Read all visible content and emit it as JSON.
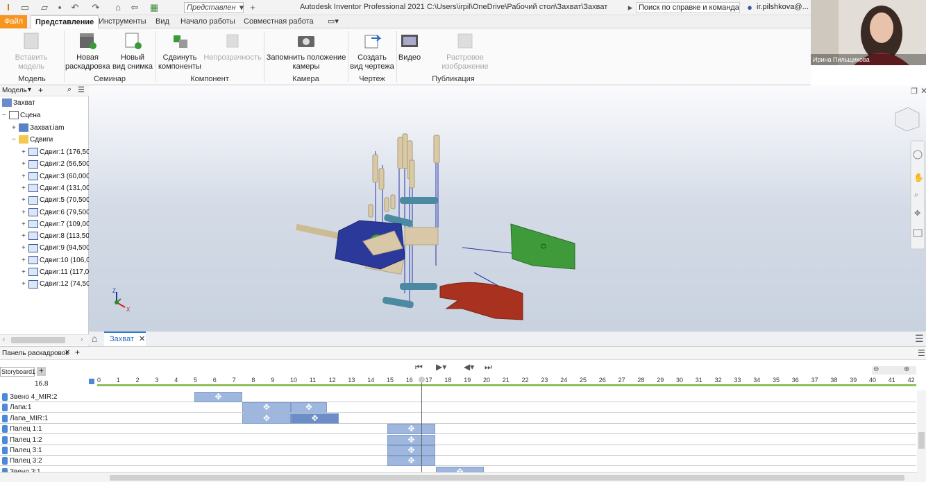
{
  "titlebar": {
    "preset": "Представлен",
    "app_title": "Autodesk Inventor Professional 2021   C:\\Users\\irpil\\OneDrive\\Рабочий стол\\Захват\\Захват",
    "help_search": "Поиск по справке и командам",
    "user": "ir.pilshkova@..."
  },
  "menu_tabs": [
    "Файл",
    "Представление",
    "Инструменты",
    "Вид",
    "Начало работы",
    "Совместная работа"
  ],
  "ribbon": {
    "buttons": [
      {
        "label1": "Вставить модель",
        "label2": "",
        "disabled": true
      },
      {
        "label1": "Новая",
        "label2": "раскадровка",
        "disabled": false
      },
      {
        "label1": "Новый",
        "label2": "вид снимка",
        "disabled": false
      },
      {
        "label1": "Сдвинуть",
        "label2": "компоненты",
        "disabled": false
      },
      {
        "label1": "Непрозрачность",
        "label2": "",
        "disabled": true
      },
      {
        "label1": "Запомнить положение",
        "label2": "камеры",
        "disabled": false
      },
      {
        "label1": "Создать",
        "label2": "вид чертежа",
        "disabled": false
      },
      {
        "label1": "Видео",
        "label2": "",
        "disabled": false
      },
      {
        "label1": "Растровое изображение",
        "label2": "",
        "disabled": true
      }
    ],
    "groups": [
      "Модель",
      "Семинар",
      "Компонент",
      "Камера",
      "Чертеж",
      "Публикация"
    ]
  },
  "webcam": {
    "name": "Ирина Пильщикова"
  },
  "browser": {
    "title": "Модель",
    "root": "Захват",
    "scene": "Сцена",
    "assembly": "Захват.iam",
    "folder": "Сдвиги",
    "tweaks": [
      "Сдвиг:1 (176,50",
      "Сдвиг:2 (56,500",
      "Сдвиг:3 (60,000",
      "Сдвиг:4 (131,00",
      "Сдвиг:5 (70,500",
      "Сдвиг:6 (79,500",
      "Сдвиг:7 (109,00",
      "Сдвиг:8 (113,50",
      "Сдвиг:9 (94,500",
      "Сдвиг:10 (106,0",
      "Сдвиг:11 (117,0",
      "Сдвиг:12 (74,50"
    ]
  },
  "doc_tab": "Захват",
  "storyboard": {
    "panel_title": "Панель раскадровок",
    "tab": "Storyboard1",
    "current_time": "16.8",
    "ticks": [
      "0",
      "1",
      "2",
      "3",
      "4",
      "5",
      "6",
      "7",
      "8",
      "9",
      "10",
      "11",
      "12",
      "13",
      "14",
      "15",
      "16",
      "17",
      "18",
      "19",
      "20",
      "21",
      "22",
      "23",
      "24",
      "25",
      "26",
      "27",
      "28",
      "29",
      "30",
      "31",
      "32",
      "33",
      "34",
      "35",
      "36",
      "37",
      "38",
      "39",
      "40",
      "41",
      "42"
    ],
    "rows": [
      "Звено 4_MIR:2",
      "Лапа:1",
      "Лапа_MIR:1",
      "Палец 1:1",
      "Палец 1:2",
      "Палец 3:1",
      "Палец 3:2",
      "Звено 3:1"
    ]
  },
  "colors": {
    "accent": "#f7941d",
    "bar": "#9fb7df",
    "blue_part": "#2b3a9a",
    "green_part": "#3f9a3a",
    "red_part": "#a8321f",
    "teal_part": "#4b8aa0",
    "tan_part": "#d8c8a8"
  }
}
